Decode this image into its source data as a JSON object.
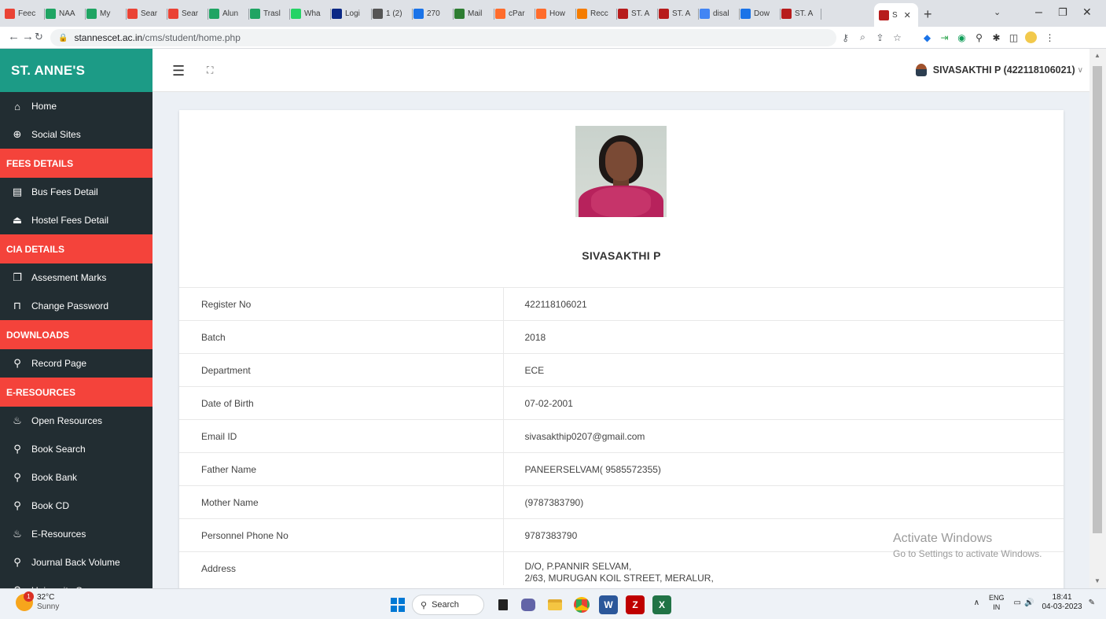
{
  "browser": {
    "tabs": [
      {
        "label": "Feec",
        "icon": "gmail-icon",
        "color": "#ea4335"
      },
      {
        "label": "NAA",
        "icon": "drive-icon",
        "color": "#1fa463"
      },
      {
        "label": "My",
        "icon": "drive-icon",
        "color": "#1fa463"
      },
      {
        "label": "Sear",
        "icon": "gmail-icon",
        "color": "#ea4335"
      },
      {
        "label": "Sear",
        "icon": "gmail-icon",
        "color": "#ea4335"
      },
      {
        "label": "Alun",
        "icon": "drive-icon",
        "color": "#1fa463"
      },
      {
        "label": "Trasl",
        "icon": "drive-icon",
        "color": "#1fa463"
      },
      {
        "label": "Wha",
        "icon": "whatsapp-icon",
        "color": "#25d366"
      },
      {
        "label": "Logi",
        "icon": "jio-icon",
        "color": "#0a2885"
      },
      {
        "label": "1 (2)",
        "icon": "globe-icon",
        "color": "#555555"
      },
      {
        "label": "270",
        "icon": "sheet-icon",
        "color": "#1a73e8"
      },
      {
        "label": "Mail",
        "icon": "mail-icon",
        "color": "#2e7d32"
      },
      {
        "label": "cPar",
        "icon": "cpanel-icon",
        "color": "#ff6c2c"
      },
      {
        "label": "How",
        "icon": "cpanel-icon",
        "color": "#ff6c2c"
      },
      {
        "label": "Recc",
        "icon": "cloud-icon",
        "color": "#f57c00"
      },
      {
        "label": "ST. A",
        "icon": "college-icon",
        "color": "#b71c1c"
      },
      {
        "label": "ST. A",
        "icon": "college-icon",
        "color": "#b71c1c"
      },
      {
        "label": "disal",
        "icon": "google-icon",
        "color": "#4285f4"
      },
      {
        "label": "Dow",
        "icon": "download-icon",
        "color": "#1a73e8"
      },
      {
        "label": "ST. A",
        "icon": "college-icon",
        "color": "#b71c1c"
      }
    ],
    "active_tab": {
      "label": "S",
      "icon": "college-icon"
    },
    "url_host": "stannescet.ac.in",
    "url_path": "/cms/student/home.php"
  },
  "sidebar": {
    "brand": "ST. ANNE'S",
    "brand_color": "#1c9b86",
    "section_color": "#f4433b",
    "groups": [
      {
        "header": null,
        "items": [
          {
            "label": "Home",
            "icon": "home-icon"
          },
          {
            "label": "Social Sites",
            "icon": "globe-icon"
          }
        ]
      },
      {
        "header": "FEES DETAILS",
        "items": [
          {
            "label": "Bus Fees Detail",
            "icon": "file-icon"
          },
          {
            "label": "Hostel Fees Detail",
            "icon": "upload-icon"
          }
        ]
      },
      {
        "header": "CIA DETAILS",
        "items": [
          {
            "label": "Assesment Marks",
            "icon": "clone-icon"
          },
          {
            "label": "Change Password",
            "icon": "lock-icon"
          }
        ]
      },
      {
        "header": "DOWNLOADS",
        "items": [
          {
            "label": "Record Page",
            "icon": "pin-icon"
          }
        ]
      },
      {
        "header": "E-RESOURCES",
        "items": [
          {
            "label": "Open Resources",
            "icon": "flame-icon"
          },
          {
            "label": "Book Search",
            "icon": "search-icon"
          },
          {
            "label": "Book Bank",
            "icon": "search-icon"
          },
          {
            "label": "Book CD",
            "icon": "search-icon"
          },
          {
            "label": "E-Resources",
            "icon": "flame-icon"
          },
          {
            "label": "Journal Back Volume",
            "icon": "search-icon"
          },
          {
            "label": "University Qpaper",
            "icon": "search-icon"
          }
        ]
      }
    ]
  },
  "header": {
    "user_label": "SIVASAKTHI P (422118106021)"
  },
  "profile": {
    "name": "SIVASAKTHI P",
    "rows": [
      {
        "label": "Register No",
        "value": "422118106021"
      },
      {
        "label": "Batch",
        "value": "2018"
      },
      {
        "label": "Department",
        "value": "ECE"
      },
      {
        "label": "Date of Birth",
        "value": "07-02-2001"
      },
      {
        "label": "Email ID",
        "value": "sivasakthip0207@gmail.com"
      },
      {
        "label": "Father Name",
        "value": "PANEERSELVAM( 9585572355)"
      },
      {
        "label": "Mother Name",
        "value": "(9787383790)"
      },
      {
        "label": "Personnel Phone No",
        "value": "9787383790"
      },
      {
        "label": "Address",
        "value": "D/O, P.PANNIR SELVAM,\n2/63, MURUGAN KOIL STREET, MERALUR,"
      }
    ]
  },
  "watermark": {
    "title": "Activate Windows",
    "subtitle": "Go to Settings to activate Windows."
  },
  "taskbar": {
    "weather_temp": "32°C",
    "weather_cond": "Sunny",
    "weather_badge": "1",
    "search_label": "Search",
    "lang_top": "ENG",
    "lang_bottom": "IN",
    "time": "18:41",
    "date": "04-03-2023"
  }
}
